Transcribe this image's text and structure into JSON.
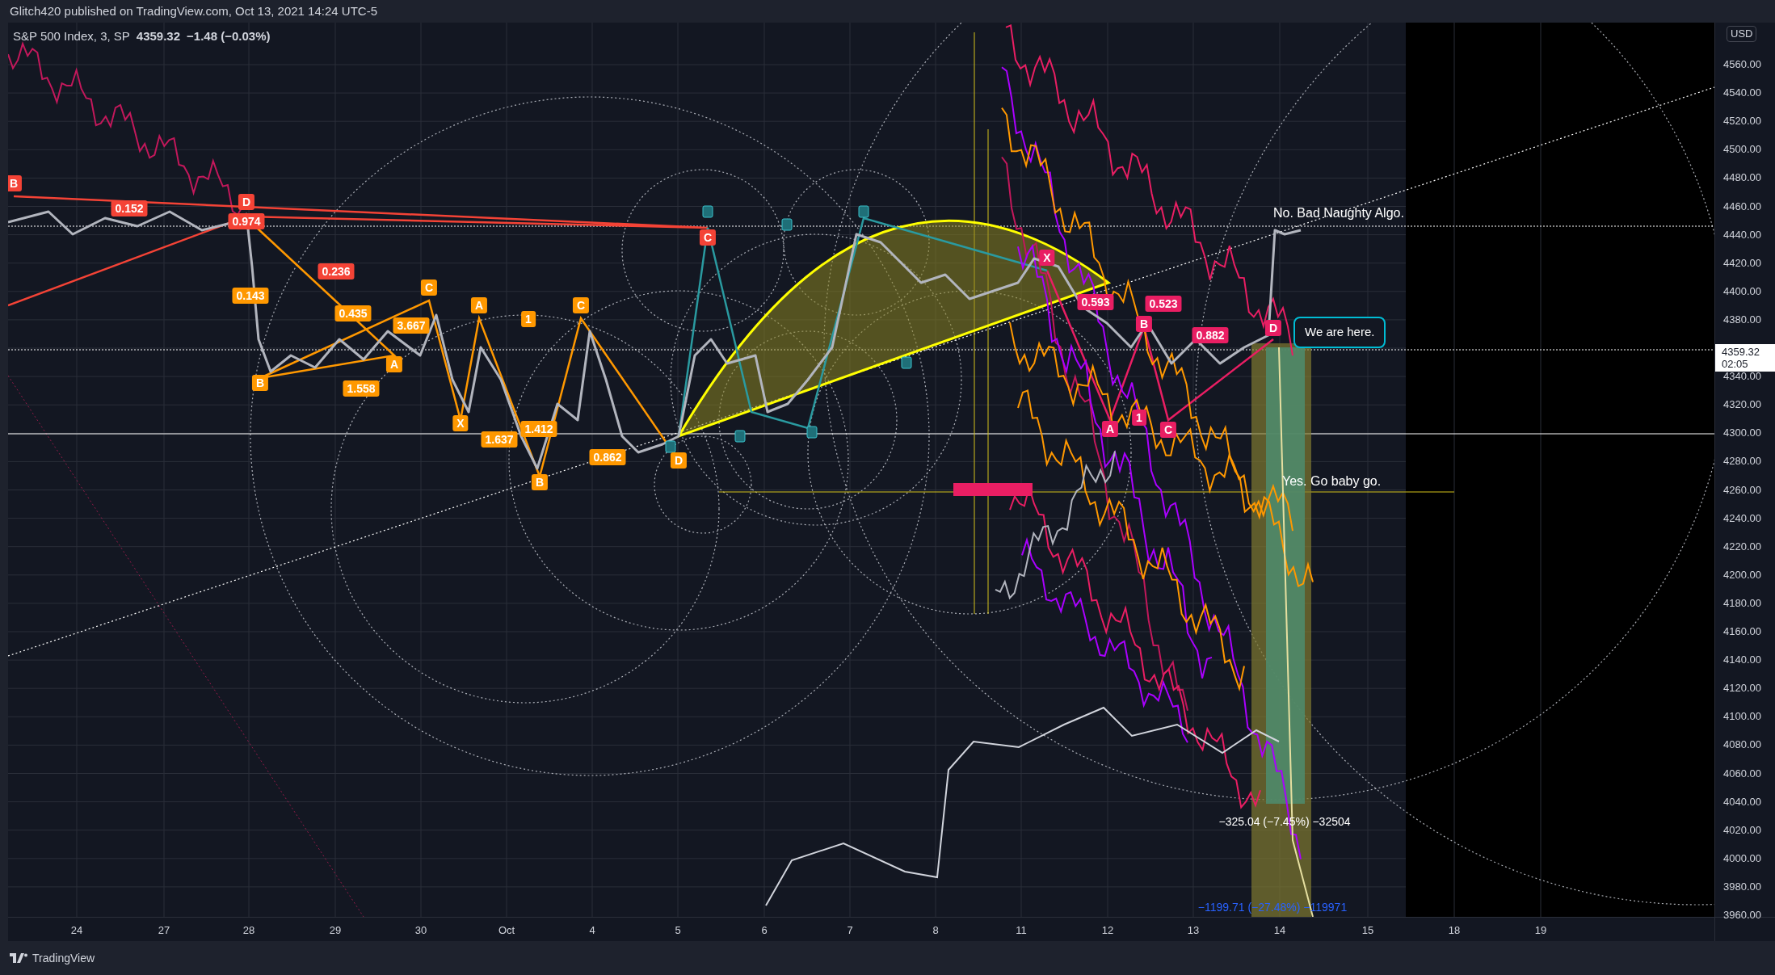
{
  "header": {
    "text": "Glitch420 published on TradingView.com, Oct 13, 2021 14:24 UTC-5"
  },
  "legend": {
    "symbol": "S&P 500 Index, 3, SP",
    "price": "4359.32",
    "change": "−1.48 (−0.03%)"
  },
  "pattern_labels": [
    {
      "text": "B",
      "color": "#f44336"
    },
    {
      "text": "0.152",
      "color": "#f44336"
    },
    {
      "text": "D",
      "color": "#f44336"
    },
    {
      "text": "0.974",
      "color": "#f44336"
    },
    {
      "text": "0.236",
      "color": "#f44336"
    },
    {
      "text": "C",
      "color": "#f44336"
    },
    {
      "text": "0.143",
      "color": "#ff9800"
    },
    {
      "text": "0.435",
      "color": "#ff9800"
    },
    {
      "text": "3.667",
      "color": "#ff9800"
    },
    {
      "text": "C",
      "color": "#ff9800"
    },
    {
      "text": "A",
      "color": "#ff9800"
    },
    {
      "text": "B",
      "color": "#ff9800"
    },
    {
      "text": "1.558",
      "color": "#ff9800"
    },
    {
      "text": "A",
      "color": "#ff9800"
    },
    {
      "text": "1",
      "color": "#ff9800"
    },
    {
      "text": "C",
      "color": "#ff9800"
    },
    {
      "text": "X",
      "color": "#ff9800"
    },
    {
      "text": "1.637",
      "color": "#ff9800"
    },
    {
      "text": "1.412",
      "color": "#ff9800"
    },
    {
      "text": "B",
      "color": "#ff9800"
    },
    {
      "text": "0.862",
      "color": "#ff9800"
    },
    {
      "text": "D",
      "color": "#ff9800"
    },
    {
      "text": "X",
      "color": "#e91e63"
    },
    {
      "text": "0.593",
      "color": "#e91e63"
    },
    {
      "text": "0.523",
      "color": "#e91e63"
    },
    {
      "text": "B",
      "color": "#e91e63"
    },
    {
      "text": "0.882",
      "color": "#e91e63"
    },
    {
      "text": "D",
      "color": "#e91e63"
    },
    {
      "text": "A",
      "color": "#e91e63"
    },
    {
      "text": "1",
      "color": "#e91e63"
    },
    {
      "text": "C",
      "color": "#e91e63"
    }
  ],
  "notes": [
    {
      "text": "No. Bad Naughty Algo.",
      "kind": "text"
    },
    {
      "text": "We are here.",
      "kind": "callout"
    },
    {
      "text": "Yes. Go baby go.",
      "kind": "text"
    }
  ],
  "measurements": [
    {
      "text": "−325.04 (−7.45%) −32504",
      "color": "#ffffff"
    },
    {
      "text": "−1199.71 (−27.48%) −119971",
      "color": "#2962ff"
    }
  ],
  "price_axis": {
    "currency": "USD",
    "last_price": "4359.32",
    "countdown": "02:05",
    "labels": [
      "4560.00",
      "4540.00",
      "4520.00",
      "4500.00",
      "4480.00",
      "4460.00",
      "4440.00",
      "4420.00",
      "4400.00",
      "4380.00",
      "4340.00",
      "4320.00",
      "4300.00",
      "4280.00",
      "4260.00",
      "4240.00",
      "4220.00",
      "4200.00",
      "4180.00",
      "4160.00",
      "4140.00",
      "4120.00",
      "4100.00",
      "4080.00",
      "4060.00",
      "4040.00",
      "4020.00",
      "4000.00",
      "3980.00",
      "3960.00"
    ]
  },
  "time_axis": {
    "labels": [
      "24",
      "27",
      "28",
      "29",
      "30",
      "Oct",
      "4",
      "5",
      "6",
      "7",
      "8",
      "11",
      "12",
      "13",
      "14",
      "15",
      "18",
      "19"
    ]
  },
  "footer": {
    "brand": "TradingView"
  }
}
